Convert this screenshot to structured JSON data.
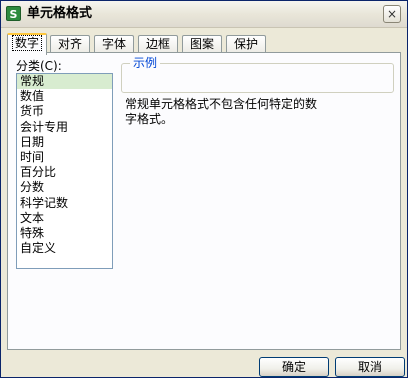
{
  "window": {
    "title": "单元格格式",
    "app_icon_glyph": "S",
    "app_icon_name": "wps-spreadsheet-icon",
    "close_glyph": "×"
  },
  "tabs": [
    {
      "label": "数字",
      "active": true
    },
    {
      "label": "对齐",
      "active": false
    },
    {
      "label": "字体",
      "active": false
    },
    {
      "label": "边框",
      "active": false
    },
    {
      "label": "图案",
      "active": false
    },
    {
      "label": "保护",
      "active": false
    }
  ],
  "category": {
    "label": "分类(C):",
    "selected": "常规",
    "items": [
      "常规",
      "数值",
      "货币",
      "会计专用",
      "日期",
      "时间",
      "百分比",
      "分数",
      "科学记数",
      "文本",
      "特殊",
      "自定义"
    ]
  },
  "sample": {
    "legend": "示例",
    "value": ""
  },
  "description": "常规单元格格式不包含任何特定的数字格式。",
  "buttons": {
    "ok": "确定",
    "cancel": "取消"
  },
  "colors": {
    "selected_row": "#d8ecd0",
    "active_tab_accent": "#ffc73c",
    "legend_text": "#0046d5"
  }
}
